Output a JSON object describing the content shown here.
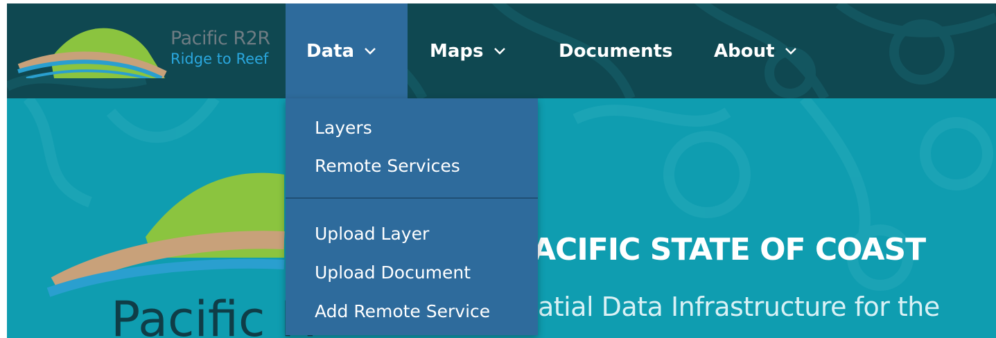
{
  "logo": {
    "title": "Pacific R2R",
    "subtitle": "Ridge to Reef"
  },
  "nav": {
    "items": [
      {
        "label": "Data",
        "has_dropdown": true,
        "active": true
      },
      {
        "label": "Maps",
        "has_dropdown": true,
        "active": false
      },
      {
        "label": "Documents",
        "has_dropdown": false,
        "active": false
      },
      {
        "label": "About",
        "has_dropdown": true,
        "active": false
      }
    ]
  },
  "dropdown": {
    "group1": [
      "Layers",
      "Remote Services"
    ],
    "group2": [
      "Upload Layer",
      "Upload Document",
      "Add Remote Service"
    ]
  },
  "hero": {
    "title": "ACIFIC STATE OF COAST",
    "subtitle": "atial Data Infrastructure for the",
    "logo_text": "Pacific R"
  },
  "colors": {
    "navbar": "#0f4851",
    "active_nav": "#2e6b9c",
    "hero_bg": "#0f9db0",
    "dropdown_bg": "#2e6b9c"
  },
  "icons": [
    "chevron-down-icon",
    "pacific-r2r-logo"
  ]
}
